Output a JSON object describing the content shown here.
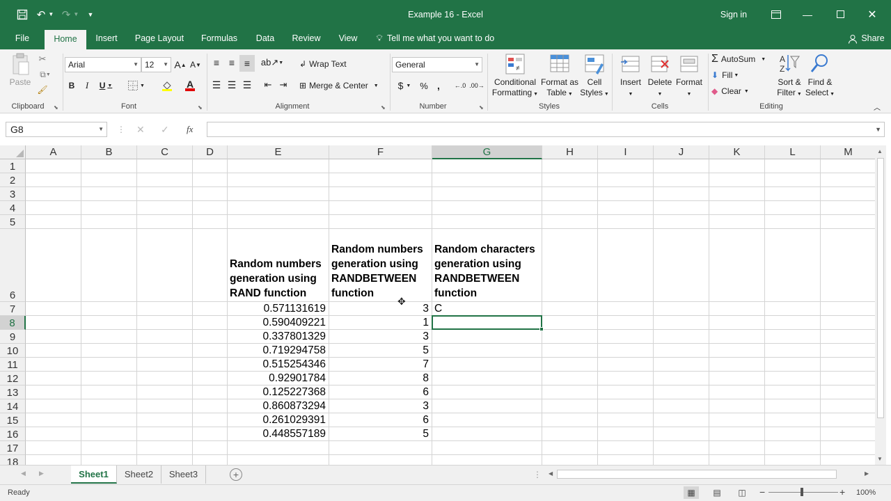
{
  "titlebar": {
    "title": "Example 16  -  Excel",
    "signin": "Sign in"
  },
  "tabs": [
    "File",
    "Home",
    "Insert",
    "Page Layout",
    "Formulas",
    "Data",
    "Review",
    "View"
  ],
  "tellme": "Tell me what you want to do",
  "share": "Share",
  "ribbon": {
    "clipboard": {
      "paste": "Paste",
      "label": "Clipboard"
    },
    "font": {
      "name": "Arial",
      "size": "12",
      "label": "Font",
      "bold": "B",
      "italic": "I",
      "underline": "U",
      "grow": "A",
      "shrink": "A"
    },
    "alignment": {
      "wrap": "Wrap Text",
      "merge": "Merge & Center",
      "label": "Alignment"
    },
    "number": {
      "format": "General",
      "label": "Number",
      "currency": "$",
      "percent": "%",
      "comma": ","
    },
    "styles": {
      "cond": [
        "Conditional",
        "Formatting"
      ],
      "fmt_table": [
        "Format as",
        "Table"
      ],
      "cell_styles": [
        "Cell",
        "Styles"
      ],
      "label": "Styles"
    },
    "cells": {
      "insert": "Insert",
      "delete": "Delete",
      "format": "Format",
      "label": "Cells"
    },
    "editing": {
      "autosum": "AutoSum",
      "fill": "Fill",
      "clear": "Clear",
      "sort": [
        "Sort &",
        "Filter"
      ],
      "find": [
        "Find &",
        "Select"
      ],
      "label": "Editing"
    }
  },
  "formula_bar": {
    "namebox": "G8",
    "fx": "fx",
    "value": ""
  },
  "columns": [
    "A",
    "B",
    "C",
    "D",
    "E",
    "F",
    "G",
    "H",
    "I",
    "J",
    "K",
    "L",
    "M"
  ],
  "selected_column": "G",
  "rows": [
    "1",
    "2",
    "3",
    "4",
    "5",
    "6",
    "7",
    "8",
    "9",
    "10",
    "11",
    "12",
    "13",
    "14",
    "15",
    "16",
    "17",
    "18"
  ],
  "selected_row": "8",
  "headers": {
    "E": "Random numbers generation using RAND function",
    "F": "Random numbers generation using RANDBETWEEN function",
    "G": "Random characters generation using RANDBETWEEN function"
  },
  "data_rows": [
    {
      "row": "7",
      "E": "0.571131619",
      "F": "3",
      "G": "C"
    },
    {
      "row": "8",
      "E": "0.590409221",
      "F": "1",
      "G": ""
    },
    {
      "row": "9",
      "E": "0.337801329",
      "F": "3",
      "G": ""
    },
    {
      "row": "10",
      "E": "0.719294758",
      "F": "5",
      "G": ""
    },
    {
      "row": "11",
      "E": "0.515254346",
      "F": "7",
      "G": ""
    },
    {
      "row": "12",
      "E": "0.92901784",
      "F": "8",
      "G": ""
    },
    {
      "row": "13",
      "E": "0.125227368",
      "F": "6",
      "G": ""
    },
    {
      "row": "14",
      "E": "0.860873294",
      "F": "3",
      "G": ""
    },
    {
      "row": "15",
      "E": "0.261029391",
      "F": "6",
      "G": ""
    },
    {
      "row": "16",
      "E": "0.448557189",
      "F": "5",
      "G": ""
    }
  ],
  "sheets": [
    "Sheet1",
    "Sheet2",
    "Sheet3"
  ],
  "active_sheet": "Sheet1",
  "status": {
    "ready": "Ready",
    "zoom": "100%"
  },
  "colors": {
    "accent": "#217346",
    "ribbon_bg": "#f3f3f3",
    "grid": "#d4d4d4"
  }
}
